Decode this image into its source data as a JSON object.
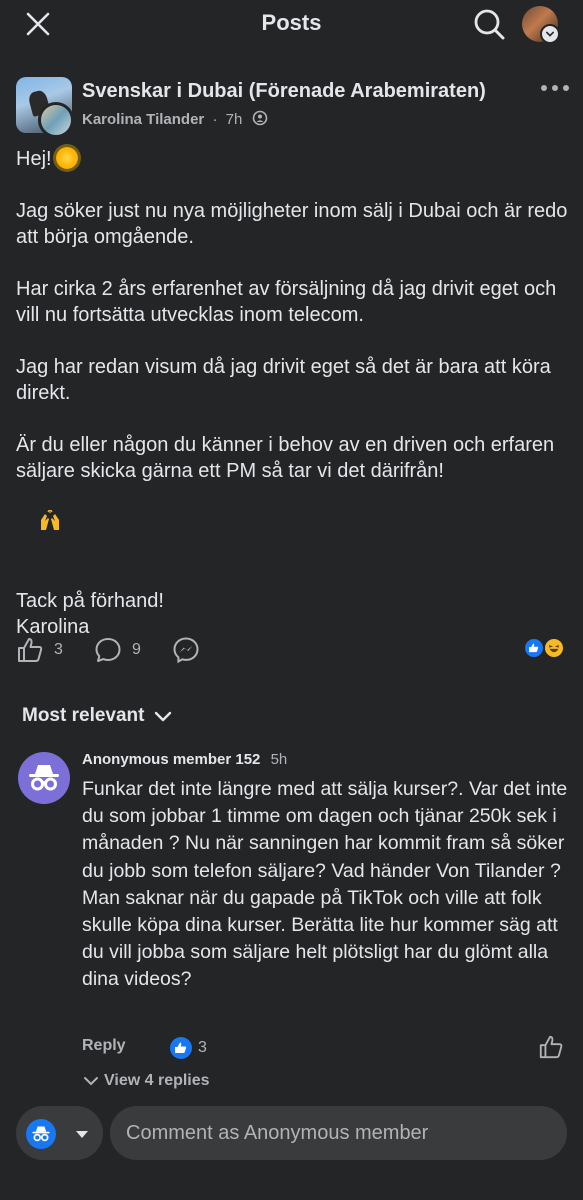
{
  "topbar": {
    "title": "Posts",
    "close_icon": "close-icon",
    "search_icon": "search-icon"
  },
  "post": {
    "group_name": "Svenskar i Dubai (Förenade Arabemiraten)",
    "author": "Karolina Tilander",
    "separator": "·",
    "time": "7h",
    "paragraphs": [
      "Hej!",
      "Jag söker just nu nya möjligheter inom sälj i Dubai och är redo att börja omgående.",
      "Har cirka 2 års erfarenhet av försäljning då jag drivit eget och vill nu fortsätta utvecklas inom telecom.",
      "Jag har redan visum då jag drivit eget så det är bara att köra direkt.",
      "Är du eller någon du känner i behov av en driven och erfaren säljare skicka gärna ett PM så tar vi det därifrån!",
      "Tack på förhand!\nKarolina"
    ],
    "likes_count": "3",
    "comments_count": "9"
  },
  "comments": {
    "sort_label": "Most relevant",
    "items": [
      {
        "name": "Anonymous member 152",
        "time": "5h",
        "text": "Funkar det inte längre med att sälja kurser?. Var det inte du som jobbar 1 timme om dagen och tjänar 250k sek i månaden ? Nu när sanningen har kommit fram så söker du jobb som telefon säljare? Vad händer Von Tilander ? Man saknar  när du gapade på TikTok och ville att folk skulle köpa dina kurser. Berätta lite hur kommer säg att du vill jobba som säljare helt plötsligt har du glömt alla dina videos?",
        "reply_label": "Reply",
        "like_count": "3",
        "view_replies": "View 4 replies"
      }
    ]
  },
  "composer": {
    "placeholder": "Comment as Anonymous member"
  },
  "colors": {
    "background": "#242526",
    "text": "#e4e6eb",
    "muted": "#b0b3b8",
    "accent": "#1877f2",
    "anon_avatar": "#7d6fd8"
  }
}
